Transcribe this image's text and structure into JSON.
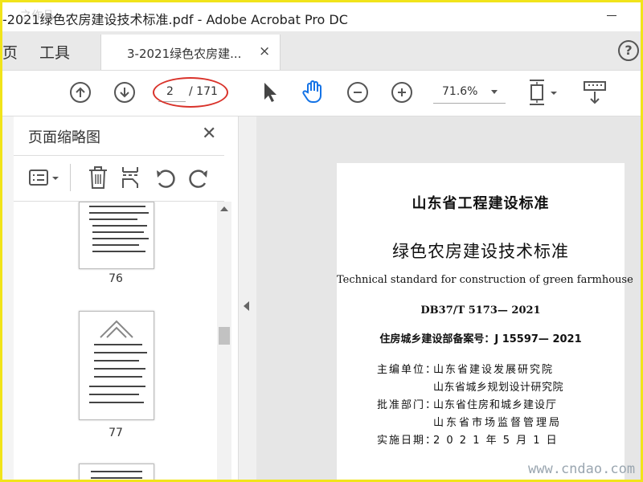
{
  "window": {
    "title": "-2021绿色农房建设技术标准.pdf - Adobe Acrobat Pro DC",
    "watermark_top": "之作品"
  },
  "tabs": {
    "home": "页",
    "tools": "工具",
    "document": "3-2021绿色农房建...",
    "close_glyph": "×",
    "help_glyph": "?"
  },
  "toolbar": {
    "current_page": "2",
    "total_pages": "/ 171",
    "zoom": "71.6%"
  },
  "left_pane": {
    "title": "页面缩略图",
    "close_glyph": "✕",
    "thumbnails": [
      {
        "number": "76"
      },
      {
        "number": "77"
      }
    ]
  },
  "document": {
    "heading": "山东省工程建设标准",
    "title": "绿色农房建设技术标准",
    "english_title": "Technical standard for construction of green farmhouse",
    "code": "DB37/T 5173— 2021",
    "record": "住房城乡建设部备案号：J 15597— 2021",
    "editor_label": "主编单位：",
    "editor_1": "山东省建设发展研究院",
    "editor_2": "山东省城乡规划设计研究院",
    "approver_label": "批准部门：",
    "approver_1": "山东省住房和城乡建设厅",
    "approver_2": "山东省市场监督管理局",
    "date_label": "实施日期：",
    "date": "2 0 2 1 年 5 月 1 日"
  },
  "watermark_bottom": "www.cndao.com",
  "colors": {
    "frame": "#f1e41a",
    "annotation_oval": "#d9322a",
    "hand_tool": "#1473e6"
  }
}
